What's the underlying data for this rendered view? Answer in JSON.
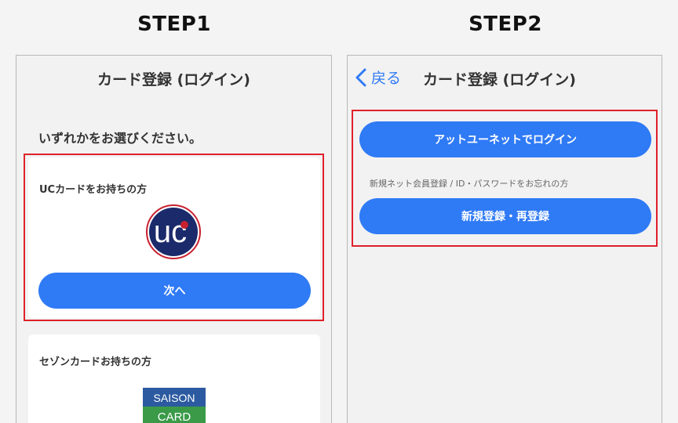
{
  "steps": {
    "step1": "STEP1",
    "step2": "STEP2"
  },
  "left_screen": {
    "title": "カード登録 (ログイン)",
    "prompt": "いずれかをお選びください。",
    "uc_card": {
      "label": "UCカードをお持ちの方",
      "logo_text": "uc",
      "button": "次へ"
    },
    "saison_card": {
      "label": "セゾンカードお持ちの方",
      "logo_line1": "SAISON",
      "logo_line2": "CARD"
    }
  },
  "right_screen": {
    "back": "戻る",
    "title": "カード登録 (ログイン)",
    "login_button": "アットユーネットでログイン",
    "note": "新規ネット会員登録 / ID・パスワードをお忘れの方",
    "register_button": "新規登録・再登録"
  },
  "colors": {
    "accent": "#2f7af5",
    "highlight": "#e0202a",
    "uc_navy": "#1b2a6b",
    "uc_red": "#c8202e",
    "saison_blue": "#2c5aa0",
    "saison_green": "#3a9a48"
  }
}
